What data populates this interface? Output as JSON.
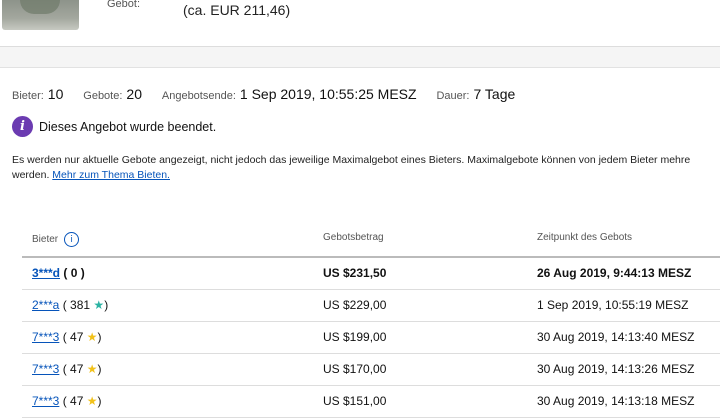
{
  "header": {
    "gebot_label": "Gebot:",
    "gebot_value": "(ca. EUR 211,46)"
  },
  "summary": {
    "bieter_label": "Bieter:",
    "bieter_value": "10",
    "gebote_label": "Gebote:",
    "gebote_value": "20",
    "ende_label": "Angebotsende:",
    "ende_value": "1 Sep 2019, 10:55:25 MESZ",
    "dauer_label": "Dauer:",
    "dauer_value": "7 Tage"
  },
  "status": {
    "icon": "info-icon",
    "text": "Dieses Angebot wurde beendet."
  },
  "info": {
    "line1": "Es werden nur aktuelle Gebote angezeigt, nicht jedoch das jeweilige Maximalgebot eines Bieters. Maximalgebote können von jedem Bieter mehre",
    "line2_prefix": "werden. ",
    "link": "Mehr zum Thema Bieten."
  },
  "table": {
    "headers": {
      "bieter": "Bieter",
      "betrag": "Gebotsbetrag",
      "zeit": "Zeitpunkt des Gebots"
    },
    "rows": [
      {
        "name": "3***d",
        "open": "(",
        "score": "0",
        "close": ")",
        "star": "",
        "amount": "US $231,50",
        "time": "26 Aug 2019, 9:44:13 MESZ"
      },
      {
        "name": "2***a",
        "open": "(",
        "score": "381",
        "close": ")",
        "star": "★",
        "amount": "US $229,00",
        "time": "1 Sep 2019, 10:55:19 MESZ"
      },
      {
        "name": "7***3",
        "open": "(",
        "score": "47",
        "close": ")",
        "star": "★",
        "amount": "US $199,00",
        "time": "30 Aug 2019, 14:13:40 MESZ"
      },
      {
        "name": "7***3",
        "open": "(",
        "score": "47",
        "close": ")",
        "star": "★",
        "amount": "US $170,00",
        "time": "30 Aug 2019, 14:13:26 MESZ"
      },
      {
        "name": "7***3",
        "open": "(",
        "score": "47",
        "close": ")",
        "star": "★",
        "amount": "US $151,00",
        "time": "30 Aug 2019, 14:13:18 MESZ"
      }
    ]
  },
  "colors": {
    "link": "#0654ba",
    "info_icon_bg": "#6b3bb1",
    "star_teal": "#2bb3a3",
    "star_yellow": "#f2c21a"
  }
}
